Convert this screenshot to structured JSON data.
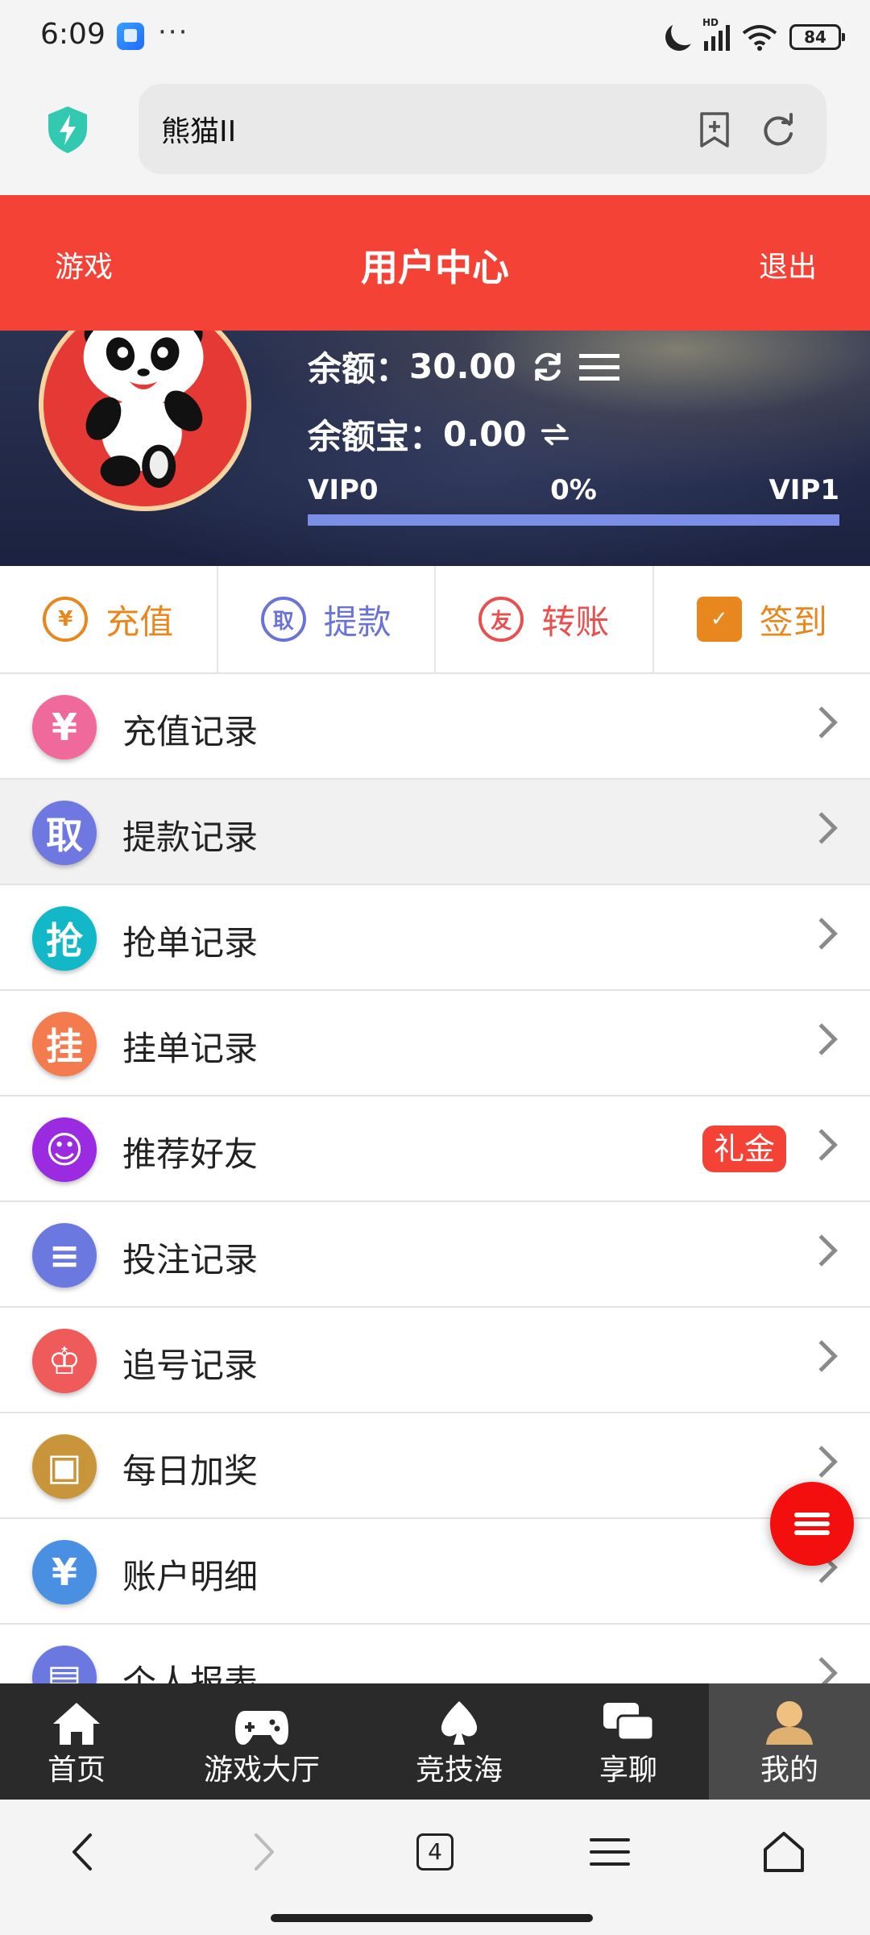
{
  "status_bar": {
    "time": "6:09",
    "dots": "···",
    "network": "HD",
    "battery": "84"
  },
  "browser": {
    "url_text": "熊猫II",
    "tab_count": "4"
  },
  "header": {
    "left": "游戏",
    "title": "用户中心",
    "right": "退出",
    "color": "#f44336"
  },
  "account": {
    "balance_label": "余额：",
    "balance_value": "30.00",
    "baoyu_label": "余额宝：",
    "baoyu_value": "0.00",
    "vip_current": "VIP0",
    "vip_progress": "0%",
    "vip_next": "VIP1",
    "vip_progress_fraction": 0
  },
  "quick_actions": [
    {
      "label": "充值",
      "icon": "yuan-coin-icon",
      "color": "#e8871e"
    },
    {
      "label": "提款",
      "icon": "withdraw-icon",
      "color": "#6b72d8"
    },
    {
      "label": "转账",
      "icon": "friend-transfer-icon",
      "color": "#e84f4f"
    },
    {
      "label": "签到",
      "icon": "calendar-check-icon",
      "color": "#e8871e"
    }
  ],
  "menu": [
    {
      "label": "充值记录",
      "icon": "recharge-record-icon",
      "color": "#ef6a9a"
    },
    {
      "label": "提款记录",
      "icon": "withdraw-record-icon",
      "color": "#6f78e0"
    },
    {
      "label": "抢单记录",
      "icon": "grab-order-icon",
      "color": "#12b8c8"
    },
    {
      "label": "挂单记录",
      "icon": "pending-order-icon",
      "color": "#f47b4e"
    },
    {
      "label": "推荐好友",
      "icon": "refer-friends-icon",
      "color": "#9a2be0",
      "badge": "礼金"
    },
    {
      "label": "投注记录",
      "icon": "bet-record-icon",
      "color": "#6a78e0"
    },
    {
      "label": "追号记录",
      "icon": "trophy-icon",
      "color": "#ef5b5b"
    },
    {
      "label": "每日加奖",
      "icon": "gift-icon",
      "color": "#c9953a"
    },
    {
      "label": "账户明细",
      "icon": "yuan-icon",
      "color": "#4a90e2"
    },
    {
      "label": "个人报表",
      "icon": "report-icon",
      "color": "#6a78e0"
    }
  ],
  "bottom_nav": [
    {
      "label": "首页",
      "icon": "home-icon"
    },
    {
      "label": "游戏大厅",
      "icon": "gamepad-icon"
    },
    {
      "label": "竞技海",
      "icon": "spade-icon"
    },
    {
      "label": "享聊",
      "icon": "chat-icon"
    },
    {
      "label": "我的",
      "icon": "user-icon"
    }
  ]
}
